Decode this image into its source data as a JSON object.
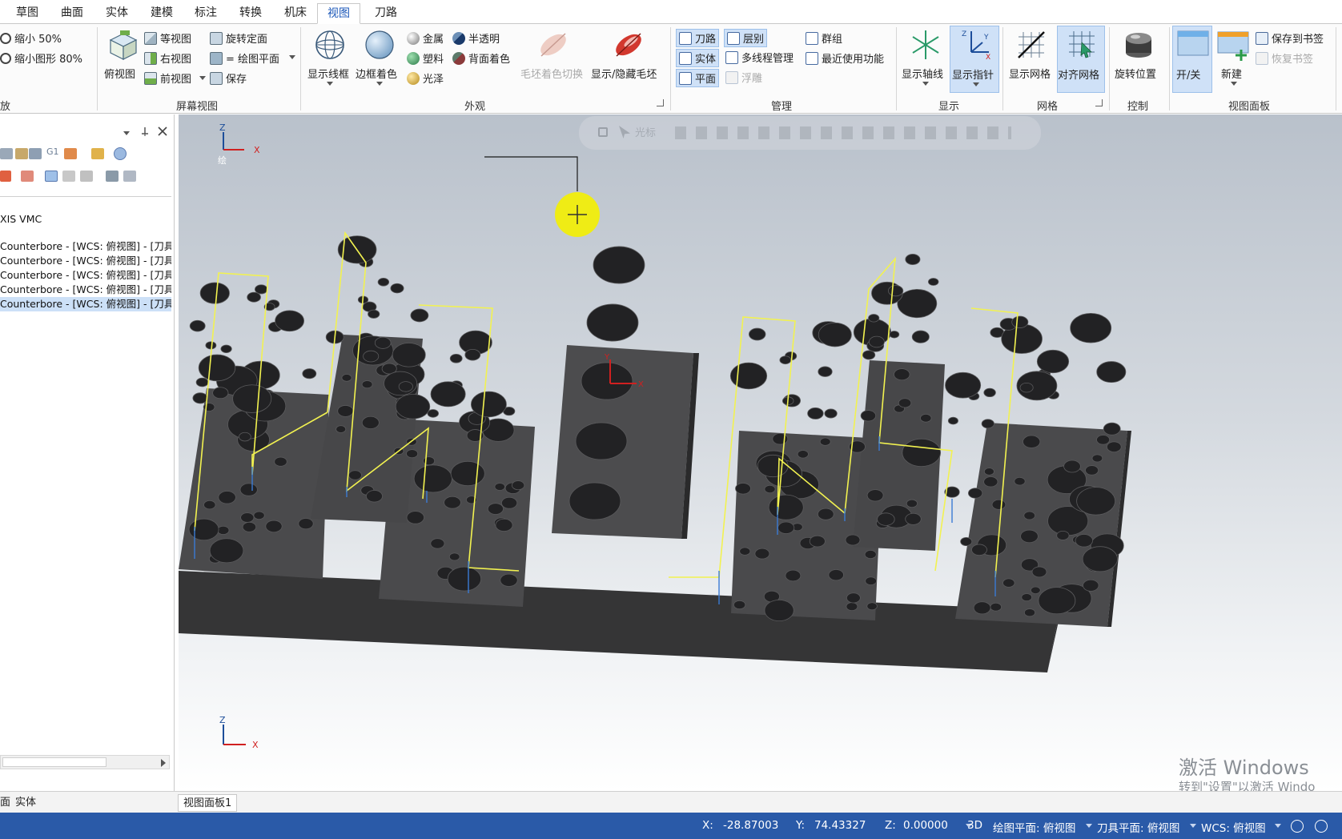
{
  "menu": {
    "tabs": [
      "草图",
      "曲面",
      "实体",
      "建模",
      "标注",
      "转换",
      "机床",
      "视图",
      "刀路"
    ],
    "active": "视图"
  },
  "ribbon": {
    "zoom": {
      "shrink50": "缩小 50%",
      "shrink80": "缩小图形 80%",
      "group": "放"
    },
    "screen_view": {
      "top_view": "俯视图",
      "iso_view": "等视图",
      "right_view": "右视图",
      "front_view": "前视图",
      "rotate_plane": "旋转定面",
      "draw_plane": "= 绘图平面",
      "save": "保存",
      "group": "屏幕视图"
    },
    "appearance": {
      "wireframe": "显示线框",
      "edge_shade": "边框着色",
      "metal": "金属",
      "plastic": "塑料",
      "gloss": "光泽",
      "translucent": "半透明",
      "backface": "背面着色",
      "stock_shade": "毛坯着色切换",
      "show_stock": "显示/隐藏毛坯",
      "group": "外观"
    },
    "manage": {
      "toolpath": "刀路",
      "solids": "实体",
      "planes": "平面",
      "levels": "层别",
      "multi_thread": "多线程管理",
      "float": "浮雕",
      "groups": "群组",
      "recent": "最近使用功能",
      "group": "管理"
    },
    "display": {
      "show_axes": "显示轴线",
      "show_gnomon": "显示指针",
      "group": "显示"
    },
    "grid": {
      "show_grid": "显示网格",
      "snap_grid": "对齐网格",
      "group": "网格"
    },
    "control": {
      "rotate_pos": "旋转位置",
      "group": "控制"
    },
    "viewsheet": {
      "on_off": "开/关",
      "new": "新建",
      "save_bookmark": "保存到书签",
      "restore_bookmark": "恢复书签",
      "group": "视图面板"
    }
  },
  "left_panel": {
    "machine": "XIS VMC",
    "ops": [
      "Counterbore - [WCS: 俯视图] - [刀具",
      "Counterbore - [WCS: 俯视图] - [刀具",
      "Counterbore - [WCS: 俯视图] - [刀具",
      "Counterbore - [WCS: 俯视图] - [刀具",
      "Counterbore - [WCS: 俯视图] - [刀具"
    ],
    "tabs": [
      "面",
      "实体"
    ],
    "g1_label": "G1"
  },
  "viewport": {
    "toolbar_hint": "光标",
    "gnomon_top": {
      "z": "Z",
      "x": "X",
      "plane": "绘"
    },
    "gnomon_bottom": {
      "z": "Z",
      "x": "X"
    },
    "origin_y": "Y",
    "origin_x": "X",
    "watermark_line1": "激活 Windows",
    "watermark_line2": "转到\"设置\"以激活 Windo"
  },
  "bottom_tabs": [
    "视图面板1"
  ],
  "status": {
    "x_label": "X:",
    "x_value": "-28.87003",
    "y_label": "Y:",
    "y_value": "74.43327",
    "z_label": "Z:",
    "z_value": "0.00000",
    "mode": "3D",
    "draw_plane": "绘图平面: 俯视图",
    "tool_plane": "刀具平面: 俯视图",
    "wcs": "WCS: 俯视图"
  },
  "colors": {
    "status_bg": "#2a5aa8",
    "toolpath_yellow": "#f2f250",
    "feed_blue": "#3a7bd5",
    "part_gray": "#4b4b4d",
    "cursor_highlight": "#f4f000"
  }
}
